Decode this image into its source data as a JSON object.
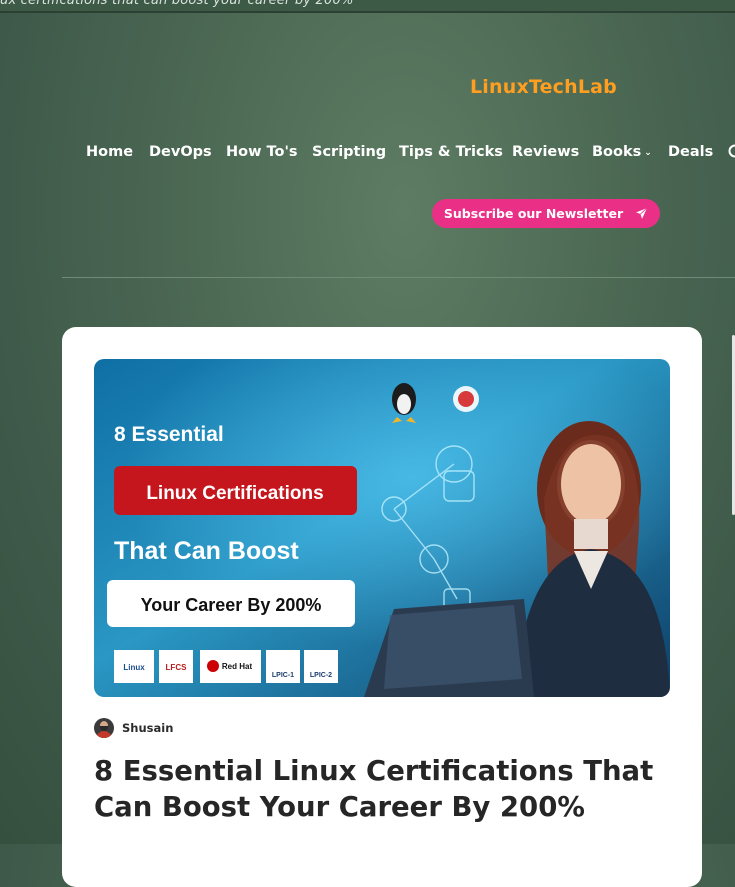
{
  "ticker": {
    "text": "ux certifications that can boost your career by 200%"
  },
  "brand": {
    "name": "LinuxTechLab",
    "color": "#ff9e1f"
  },
  "nav": {
    "items": [
      {
        "label": "Home"
      },
      {
        "label": "DevOps"
      },
      {
        "label": "How To's"
      },
      {
        "label": "Scripting"
      },
      {
        "label": "Tips & Tricks"
      },
      {
        "label": "Reviews"
      },
      {
        "label": "Books",
        "has_dropdown": true
      },
      {
        "label": "Deals"
      }
    ],
    "search_icon": "search-icon",
    "dropdown_icon": "chevron-down-icon"
  },
  "subscribe": {
    "label": "Subscribe our Newsletter",
    "icon": "paper-plane-icon",
    "color": "#ea2f87"
  },
  "article": {
    "author": "Shusain",
    "title": "8 Essential Linux Certifications That Can Boost Your Career By 200%",
    "image": {
      "line1": "8 Essential",
      "line2": "Linux Certifications",
      "line3": "That Can Boost",
      "line4": "Your Career By 200%",
      "badges": [
        "Linux",
        "LFCS",
        "Red Hat",
        "LPIC-1",
        "LPIC-2"
      ]
    }
  }
}
